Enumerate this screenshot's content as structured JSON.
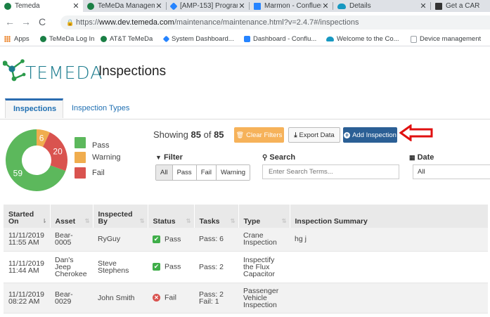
{
  "browser": {
    "tabs": [
      {
        "label": "Temeda",
        "icon": "temeda-favicon",
        "color": "#1a7f45"
      },
      {
        "label": "TeMeDa Manageme",
        "icon": "temeda-favicon",
        "color": "#1a7f45"
      },
      {
        "label": "[AMP-153] Program",
        "icon": "jira-favicon",
        "color": "#2684ff"
      },
      {
        "label": "Marmon - Confluen",
        "icon": "confluence-favicon",
        "color": "#2684ff"
      },
      {
        "label": "Details",
        "icon": "salesforce-favicon",
        "color": "#1798c1"
      },
      {
        "label": "Get a CAR",
        "icon": "car-favicon",
        "color": "#333333"
      }
    ],
    "url_prefix": "https://",
    "url_host": "www.dev.temeda.com",
    "url_path": "/maintenance/maintenance.html?v=2.4.7#/inspections",
    "bookmarks": [
      {
        "label": "Apps",
        "icon": "apps-grid-icon",
        "color": "#e8710a"
      },
      {
        "label": "TeMeDa Log In",
        "icon": "temeda-favicon",
        "color": "#1a7f45"
      },
      {
        "label": "AT&T TeMeDa",
        "icon": "temeda-favicon",
        "color": "#1a7f45"
      },
      {
        "label": "System Dashboard...",
        "icon": "jira-favicon",
        "color": "#2684ff"
      },
      {
        "label": "Dashboard - Conflu...",
        "icon": "confluence-favicon",
        "color": "#2684ff"
      },
      {
        "label": "Welcome to the Co...",
        "icon": "salesforce-favicon",
        "color": "#1798c1"
      },
      {
        "label": "Device management",
        "icon": "doc-favicon",
        "color": "#9aa0a6"
      }
    ]
  },
  "app": {
    "logo": "TEMEDA",
    "page_title": "Inspections",
    "tabs": [
      "Inspections",
      "Inspection Types"
    ]
  },
  "summary": {
    "legend": [
      {
        "label": "Pass",
        "color": "#5cb85c"
      },
      {
        "label": "Warning",
        "color": "#f0ad4e"
      },
      {
        "label": "Fail",
        "color": "#d9534f"
      }
    ],
    "chart_data": {
      "type": "pie",
      "categories": [
        "Pass",
        "Warning",
        "Fail"
      ],
      "values": [
        59,
        6,
        20
      ]
    },
    "showing_prefix": "Showing",
    "showing_count": "85",
    "showing_of": "of",
    "showing_total": "85"
  },
  "toolbar": {
    "clear_filters": "Clear Filters",
    "export": "Export Data",
    "add": "Add Inspection"
  },
  "filters": {
    "filter_label": "Filter",
    "filter_options": [
      "All",
      "Pass",
      "Fail",
      "Warning"
    ],
    "filter_selected": "All",
    "search_label": "Search",
    "search_placeholder": "Enter Search Terms...",
    "date_label": "Date",
    "date_value": "All"
  },
  "table": {
    "headers": [
      "Started On",
      "Asset",
      "Inspected By",
      "Status",
      "Tasks",
      "Type",
      "Inspection Summary"
    ],
    "rows": [
      {
        "started_date": "11/11/2019",
        "started_time": "11:55 AM",
        "asset": "Bear-0005",
        "inspected_by": "RyGuy",
        "status": "Pass",
        "tasks": "Pass: 6",
        "type": "Crane Inspection",
        "summary": "hg j"
      },
      {
        "started_date": "11/11/2019",
        "started_time": "11:44 AM",
        "asset": "Dan's Jeep Cherokee",
        "inspected_by": "Steve Stephens",
        "status": "Pass",
        "tasks": "Pass: 2",
        "type": "Inspectify the Flux Capacitor",
        "summary": ""
      },
      {
        "started_date": "11/11/2019",
        "started_time": "08:22 AM",
        "asset": "Bear-0029",
        "inspected_by": "John Smith",
        "status": "Fail",
        "tasks": "Pass: 2 Fail: 1",
        "type": "Passenger Vehicle Inspection",
        "summary": ""
      }
    ]
  }
}
